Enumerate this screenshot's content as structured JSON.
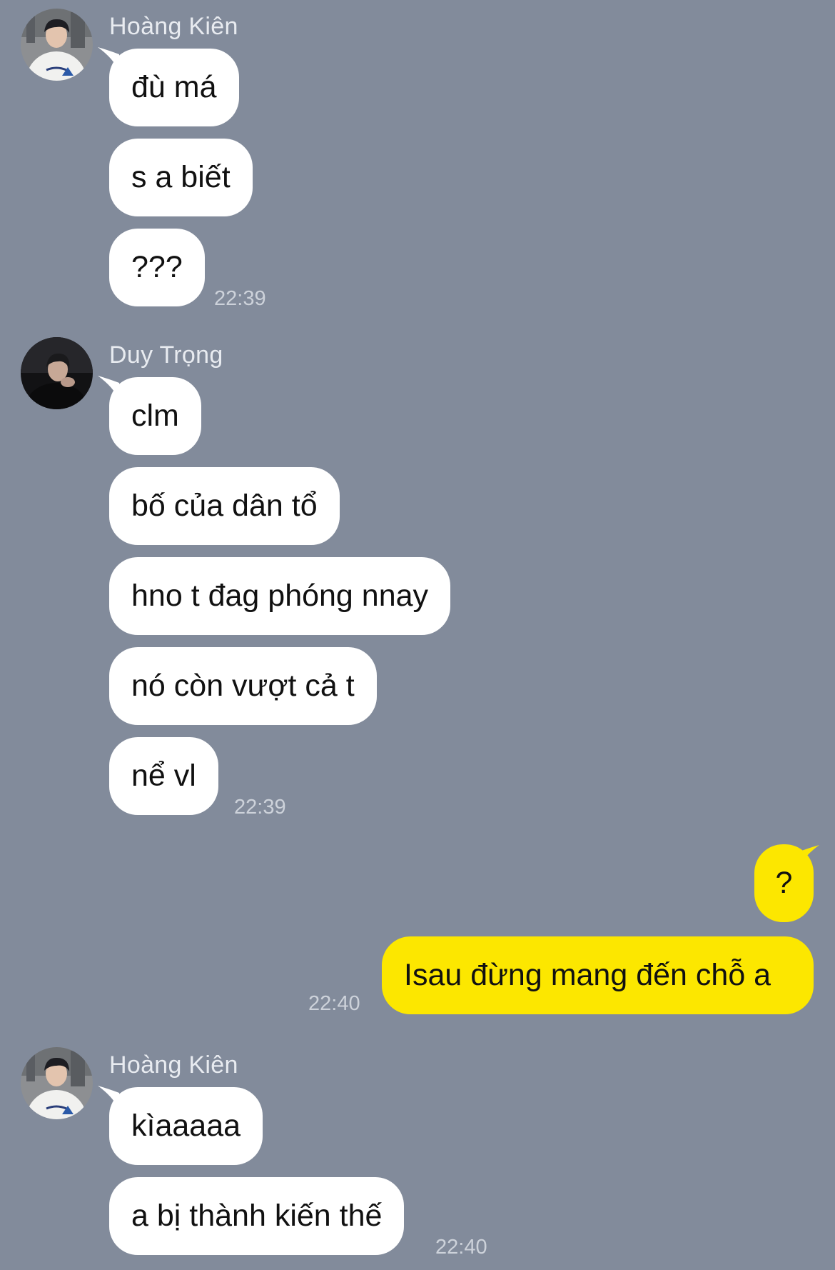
{
  "conversation": {
    "group1": {
      "sender": "Hoàng Kiên",
      "messages": [
        "đù má",
        "s a biết",
        "???"
      ],
      "time": "22:39"
    },
    "group2": {
      "sender": "Duy Trọng",
      "messages": [
        "clm",
        "bố của dân tổ",
        "hno t đag phóng nnay",
        "nó còn vượt cả t",
        "nể vl"
      ],
      "time": "22:39"
    },
    "group3": {
      "messages": [
        "?",
        "Isau đừng mang đến chỗ a"
      ],
      "time": "22:40"
    },
    "group4": {
      "sender": "Hoàng Kiên",
      "messages": [
        "kìaaaaa",
        "a bị thành kiến thế"
      ],
      "time": "22:40"
    }
  },
  "colors": {
    "background": "#828b9b",
    "incoming_bubble": "#ffffff",
    "outgoing_bubble": "#fce700"
  },
  "icons": {
    "avatar_hoang_kien": "profile-photo",
    "avatar_duy_trong": "profile-photo"
  }
}
